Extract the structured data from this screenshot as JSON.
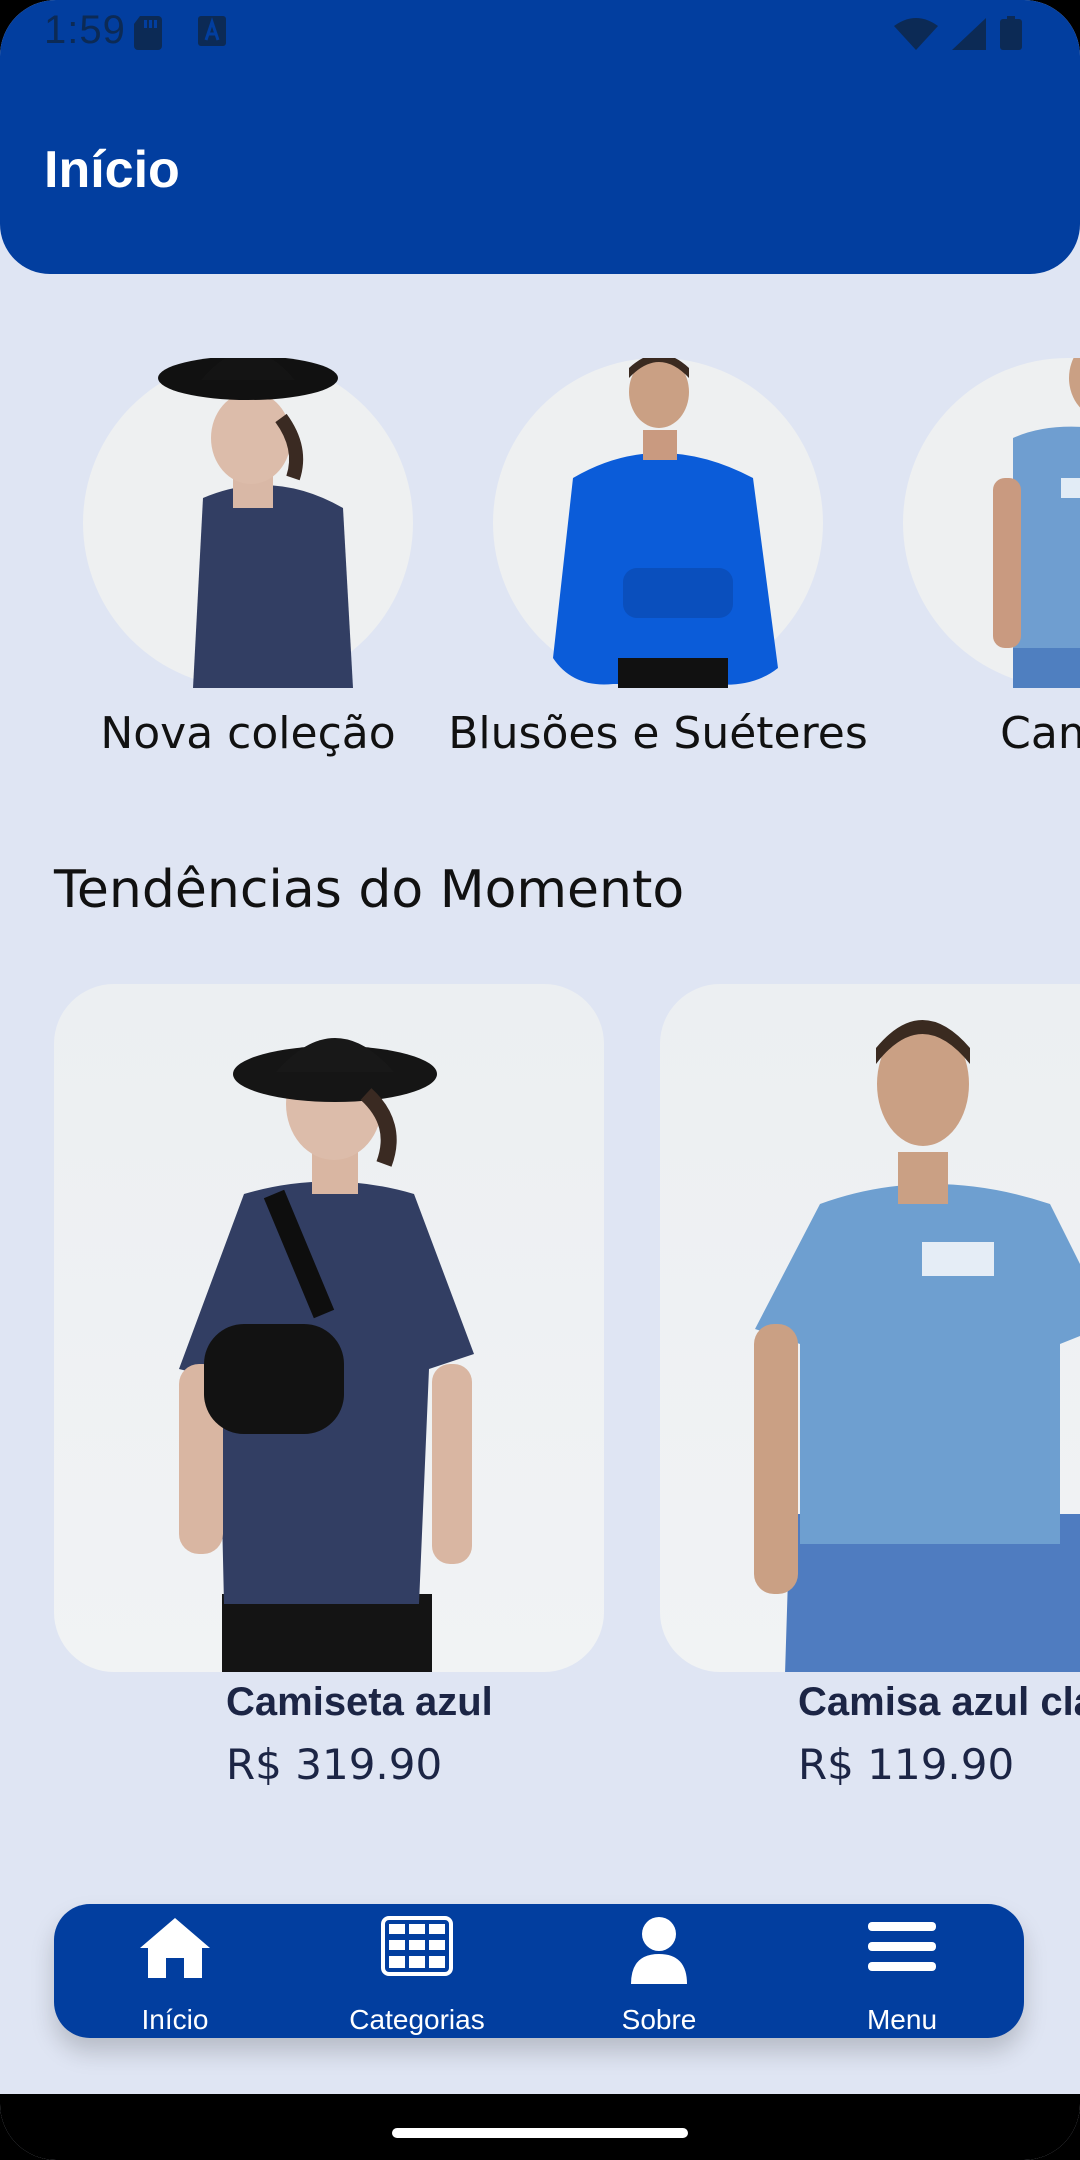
{
  "status_bar": {
    "time": "1:59",
    "icons": [
      "sd-card-icon",
      "autofill-icon",
      "wifi-icon",
      "cellular-signal-icon",
      "battery-icon"
    ]
  },
  "app_bar": {
    "title": "Início",
    "color": "#023e9f"
  },
  "categories": [
    {
      "label": "Nova coleção"
    },
    {
      "label": "Blusões e Suéteres"
    },
    {
      "label": "Camis"
    }
  ],
  "trending": {
    "title": "Tendências do Momento",
    "products": [
      {
        "name": "Camiseta azul",
        "price": "R$ 319.90"
      },
      {
        "name": "Camisa azul cla",
        "price": "R$ 119.90"
      }
    ]
  },
  "bottom_nav": {
    "items": [
      {
        "label": "Início",
        "icon": "home-icon"
      },
      {
        "label": "Categorias",
        "icon": "grid-icon"
      },
      {
        "label": "Sobre",
        "icon": "person-icon"
      },
      {
        "label": "Menu",
        "icon": "menu-icon"
      }
    ]
  },
  "colors": {
    "primary": "#023e9f",
    "background": "#dfe5f3",
    "text_dark": "#1c2545"
  }
}
